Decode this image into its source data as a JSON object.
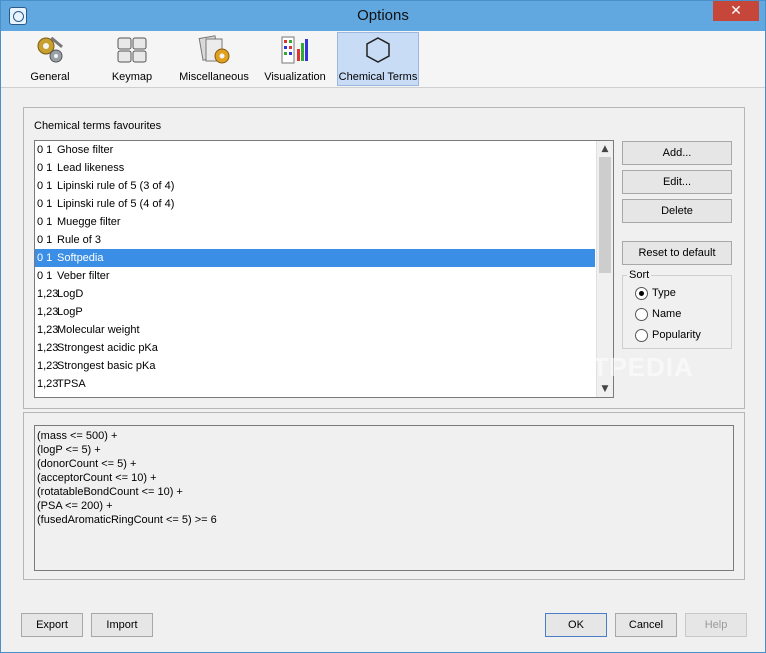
{
  "window": {
    "title": "Options",
    "close_label": "✕"
  },
  "toolbar": {
    "tabs": [
      {
        "label": "General",
        "icon": "gears-icon"
      },
      {
        "label": "Keymap",
        "icon": "keyboard-icon"
      },
      {
        "label": "Miscellaneous",
        "icon": "folders-gear-icon"
      },
      {
        "label": "Visualization",
        "icon": "chart-grid-icon"
      },
      {
        "label": "Chemical Terms",
        "icon": "hexagon-icon",
        "active": true
      }
    ]
  },
  "favourites": {
    "label": "Chemical terms favourites",
    "items": [
      {
        "prefix": "0 1",
        "label": "Ghose filter"
      },
      {
        "prefix": "0 1",
        "label": "Lead likeness"
      },
      {
        "prefix": "0 1",
        "label": "Lipinski rule of 5 (3 of 4)"
      },
      {
        "prefix": "0 1",
        "label": "Lipinski rule of 5 (4 of 4)"
      },
      {
        "prefix": "0 1",
        "label": "Muegge filter"
      },
      {
        "prefix": "0 1",
        "label": "Rule of 3"
      },
      {
        "prefix": "0 1",
        "label": "Softpedia",
        "selected": true
      },
      {
        "prefix": "0 1",
        "label": "Veber filter"
      },
      {
        "prefix": "1,23",
        "label": "LogD"
      },
      {
        "prefix": "1,23",
        "label": "LogP"
      },
      {
        "prefix": "1,23",
        "label": "Molecular weight"
      },
      {
        "prefix": "1,23",
        "label": "Strongest acidic pKa"
      },
      {
        "prefix": "1,23",
        "label": "Strongest basic pKa"
      },
      {
        "prefix": "1,23",
        "label": "TPSA"
      }
    ]
  },
  "buttons": {
    "add": "Add...",
    "edit": "Edit...",
    "delete": "Delete",
    "reset": "Reset to default",
    "export": "Export",
    "import": "Import",
    "ok": "OK",
    "cancel": "Cancel",
    "help": "Help"
  },
  "sort": {
    "label": "Sort",
    "options": [
      {
        "label": "Type",
        "checked": true
      },
      {
        "label": "Name",
        "checked": false
      },
      {
        "label": "Popularity",
        "checked": false
      }
    ]
  },
  "expression": {
    "lines": [
      "(mass <= 500) +",
      "(logP <= 5) +",
      "(donorCount <= 5) +",
      "(acceptorCount <= 10) +",
      "(rotatableBondCount <= 10) +",
      "(PSA <= 200) +",
      "(fusedAromaticRingCount <= 5) >= 6"
    ]
  },
  "watermark": "SOFTPEDIA",
  "colors": {
    "titlebar": "#62a8e0",
    "selection": "#3b8ee6",
    "close": "#c7463a"
  }
}
